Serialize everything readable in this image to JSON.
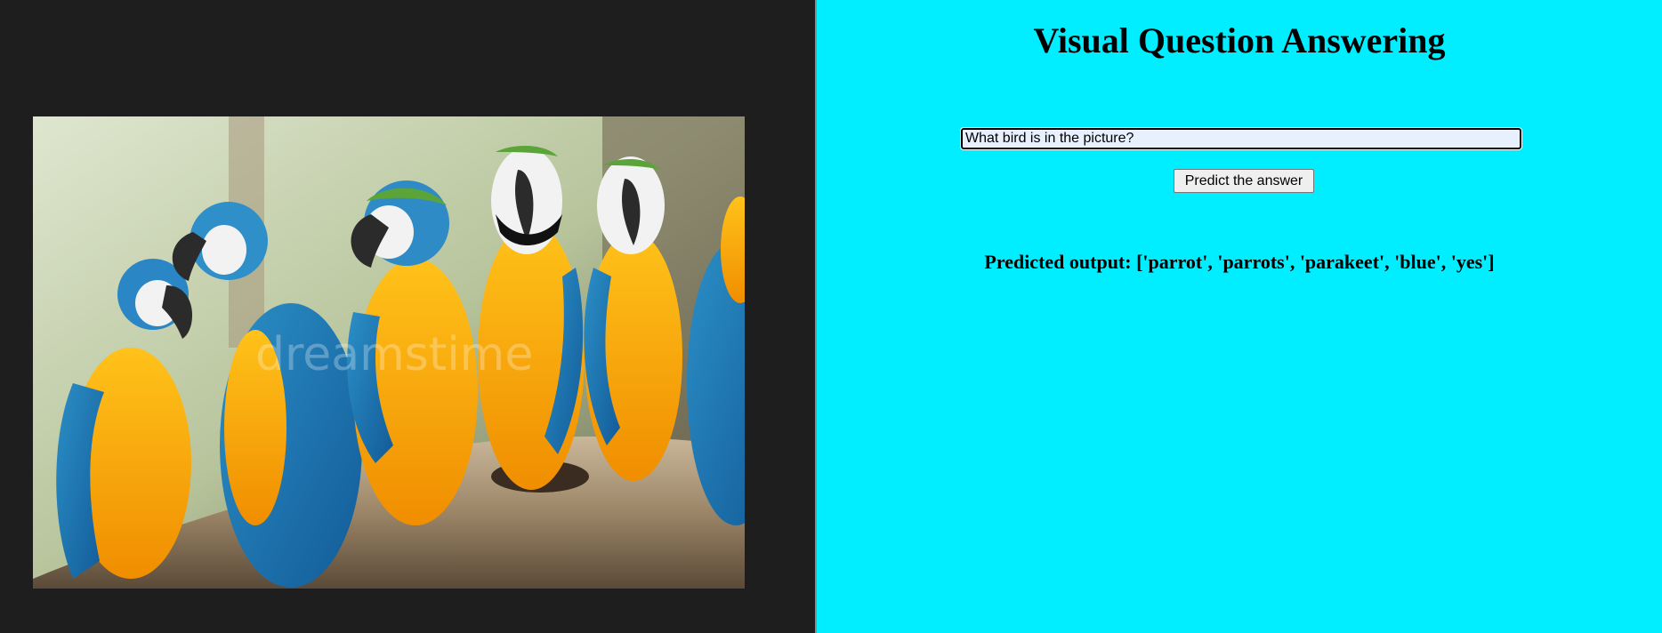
{
  "page": {
    "title": "Visual Question Answering",
    "question": {
      "value": "What bird is in the picture?",
      "placeholder": ""
    },
    "submit_label": "Predict the answer",
    "output_label": "Predicted output:",
    "output_value": "['parrot', 'parrots', 'parakeet', 'blue', 'yes']"
  },
  "image": {
    "subject": "blue-and-yellow macaws perched on a log",
    "watermark": "dreamstime"
  },
  "colors": {
    "left_background": "#1e1e1e",
    "right_background": "#00eeff",
    "input_background": "#e8f0fe",
    "button_background": "#efefef"
  }
}
